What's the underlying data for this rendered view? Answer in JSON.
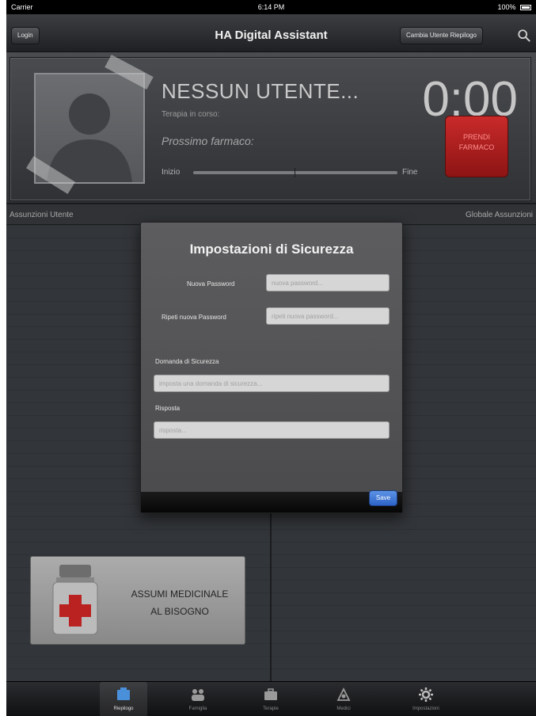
{
  "status_bar": {
    "carrier": "Carrier",
    "time": "6:14 PM",
    "battery": "100%"
  },
  "nav": {
    "login_label": "Login",
    "title": "HA Digital Assistant",
    "switch_user_label": "Cambia Utente Riepilogo"
  },
  "header": {
    "user_name": "NESSUN UTENTE...",
    "therapy": "Terapia in corso:",
    "next_drug": "Prossimo farmaco:",
    "timer": "0:00",
    "take_button_line1": "PRENDI",
    "take_button_line2": "FARMACO",
    "progress_start": "Inizio",
    "progress_end": "Fine"
  },
  "subheader": {
    "left": "Assunzioni Utente",
    "right": "Globale Assunzioni"
  },
  "dialog": {
    "title": "Impostazioni di Sicurezza",
    "new_password_label": "Nuova Password",
    "new_password_placeholder": "nuova password...",
    "repeat_password_label": "Ripeti nuova Password",
    "repeat_password_placeholder": "ripeti nuova password...",
    "question_label": "Domanda di Sicurezza",
    "question_placeholder": "imposta una domanda di sicurezza...",
    "answer_label": "Risposta",
    "answer_placeholder": "risposta...",
    "save_label": "Save"
  },
  "assumi_card": {
    "line1": "ASSUMI MEDICINALE",
    "line2": "AL BISOGNO"
  },
  "tabbar": {
    "items": [
      {
        "label": "Riepilogo",
        "icon": "summary-icon",
        "active": true
      },
      {
        "label": "Famiglia",
        "icon": "family-icon",
        "active": false
      },
      {
        "label": "Terapie",
        "icon": "briefcase-icon",
        "active": false
      },
      {
        "label": "Medici",
        "icon": "doctor-icon",
        "active": false
      },
      {
        "label": "Impostazioni",
        "icon": "gear-icon",
        "active": false
      }
    ]
  },
  "colors": {
    "accent_red": "#c92a2a",
    "save_blue": "#2d63c7",
    "background": "#3a3d41"
  }
}
